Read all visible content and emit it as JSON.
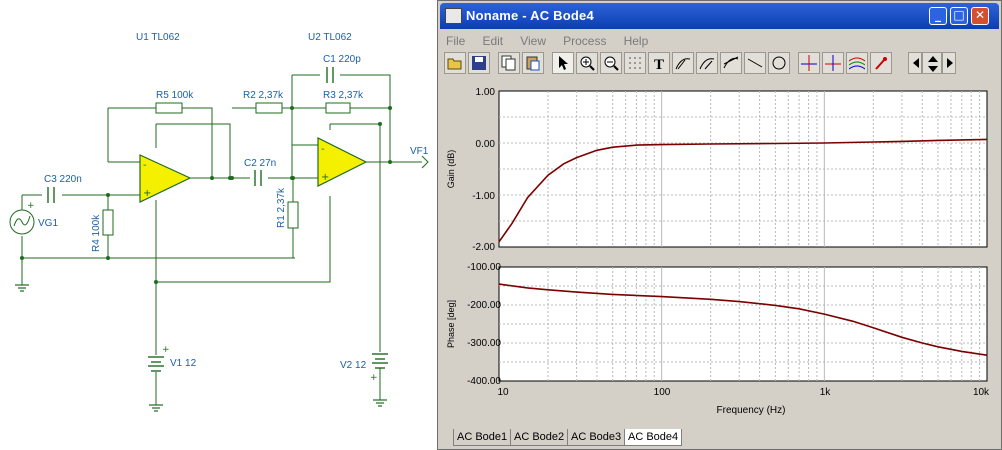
{
  "schematic": {
    "u1": "U1 TL062",
    "u2": "U2 TL062",
    "c1": "C1 220p",
    "r5": "R5 100k",
    "r2": "R2 2,37k",
    "r3": "R3 2,37k",
    "c3": "C3 220n",
    "c2": "C2 27n",
    "r4": "R4 100k",
    "r1": "R1 2,37k",
    "vg1": "VG1",
    "vf1": "VF1",
    "v1": "V1 12",
    "v2": "V2 12",
    "plus": "+",
    "minus": "-"
  },
  "window": {
    "title": "Noname - AC Bode4",
    "min_glyph": "_",
    "max_glyph": "□",
    "close_glyph": "✕"
  },
  "menu": [
    "File",
    "Edit",
    "View",
    "Process",
    "Help"
  ],
  "toolbar": [
    "open-icon",
    "save-icon",
    "copy-icon",
    "paste-icon",
    "pointer-icon",
    "zoom-in-icon",
    "zoom-out-icon",
    "grid-icon",
    "text-icon",
    "cursor-a-icon",
    "cursor-b-icon",
    "tangent-icon",
    "line-icon",
    "circle-icon",
    "marker-a-icon",
    "marker-b-icon",
    "curves-icon",
    "pick-icon",
    "pan-left-icon",
    "pan-updown-icon",
    "pan-right-icon"
  ],
  "chart_data": [
    {
      "type": "line",
      "title": "",
      "xlabel": "",
      "ylabel": "Gain (dB)",
      "x_scale": "log",
      "xlim": [
        10,
        10000
      ],
      "ylim": [
        -2.0,
        1.0
      ],
      "yticks": [
        "1.00",
        "0.00",
        "-1.00",
        "-2.00"
      ],
      "xticks": [
        "10",
        "100",
        "1k",
        "10k"
      ],
      "grid": true,
      "color": "#7a0000",
      "series": [
        {
          "x": [
            10,
            12,
            15,
            20,
            25,
            30,
            40,
            50,
            70,
            100,
            200,
            500,
            1000,
            2000,
            3000,
            5000,
            7000,
            10000
          ],
          "y": [
            -1.9,
            -1.55,
            -1.05,
            -0.62,
            -0.4,
            -0.28,
            -0.14,
            -0.08,
            -0.04,
            -0.03,
            -0.02,
            -0.01,
            0.0,
            0.02,
            0.03,
            0.05,
            0.06,
            0.07
          ]
        }
      ]
    },
    {
      "type": "line",
      "title": "",
      "xlabel": "Frequency (Hz)",
      "ylabel": "Phase [deg]",
      "x_scale": "log",
      "xlim": [
        10,
        10000
      ],
      "ylim": [
        -400,
        -100
      ],
      "yticks": [
        "-100.00",
        "-200.00",
        "-300.00",
        "-400.00"
      ],
      "xticks": [
        "10",
        "100",
        "1k",
        "10k"
      ],
      "grid": true,
      "color": "#7a0000",
      "series": [
        {
          "x": [
            10,
            15,
            20,
            30,
            50,
            100,
            200,
            300,
            500,
            700,
            1000,
            1500,
            2000,
            3000,
            4000,
            5000,
            7000,
            10000
          ],
          "y": [
            -145,
            -155,
            -160,
            -166,
            -172,
            -178,
            -185,
            -191,
            -201,
            -210,
            -224,
            -243,
            -260,
            -285,
            -300,
            -310,
            -322,
            -332
          ]
        }
      ]
    }
  ],
  "tabs": [
    "AC Bode1",
    "AC Bode2",
    "AC Bode3",
    "AC Bode4"
  ],
  "active_tab": 3
}
